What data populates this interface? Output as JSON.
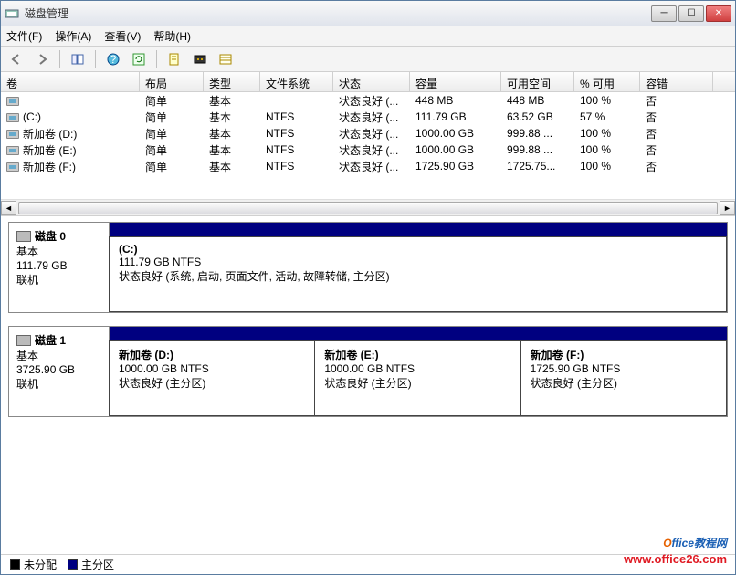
{
  "window": {
    "title": "磁盘管理"
  },
  "menus": {
    "file": "文件(F)",
    "action": "操作(A)",
    "view": "查看(V)",
    "help": "帮助(H)"
  },
  "toolbar_icons": [
    "back-icon",
    "forward-icon",
    "up-icon",
    "help-icon",
    "refresh-icon",
    "properties-icon",
    "list-icon",
    "detail-icon"
  ],
  "columns": {
    "c0": "卷",
    "c1": "布局",
    "c2": "类型",
    "c3": "文件系统",
    "c4": "状态",
    "c5": "容量",
    "c6": "可用空间",
    "c7": "% 可用",
    "c8": "容错"
  },
  "volumes": [
    {
      "name": "",
      "layout": "简单",
      "type": "基本",
      "fs": "",
      "status": "状态良好 (...",
      "cap": "448 MB",
      "free": "448 MB",
      "pct": "100 %",
      "ft": "否"
    },
    {
      "name": "(C:)",
      "layout": "简单",
      "type": "基本",
      "fs": "NTFS",
      "status": "状态良好 (...",
      "cap": "111.79 GB",
      "free": "63.52 GB",
      "pct": "57 %",
      "ft": "否"
    },
    {
      "name": "新加卷 (D:)",
      "layout": "简单",
      "type": "基本",
      "fs": "NTFS",
      "status": "状态良好 (...",
      "cap": "1000.00 GB",
      "free": "999.88 ...",
      "pct": "100 %",
      "ft": "否"
    },
    {
      "name": "新加卷 (E:)",
      "layout": "简单",
      "type": "基本",
      "fs": "NTFS",
      "status": "状态良好 (...",
      "cap": "1000.00 GB",
      "free": "999.88 ...",
      "pct": "100 %",
      "ft": "否"
    },
    {
      "name": "新加卷 (F:)",
      "layout": "简单",
      "type": "基本",
      "fs": "NTFS",
      "status": "状态良好 (...",
      "cap": "1725.90 GB",
      "free": "1725.75...",
      "pct": "100 %",
      "ft": "否"
    }
  ],
  "disks": [
    {
      "id": "磁盘 0",
      "type": "基本",
      "size": "111.79 GB",
      "status": "联机",
      "parts": [
        {
          "label": "(C:)",
          "sub": "111.79 GB NTFS",
          "state": "状态良好 (系统, 启动, 页面文件, 活动, 故障转储, 主分区)"
        }
      ]
    },
    {
      "id": "磁盘 1",
      "type": "基本",
      "size": "3725.90 GB",
      "status": "联机",
      "parts": [
        {
          "label": "新加卷  (D:)",
          "sub": "1000.00 GB NTFS",
          "state": "状态良好 (主分区)"
        },
        {
          "label": "新加卷  (E:)",
          "sub": "1000.00 GB NTFS",
          "state": "状态良好 (主分区)"
        },
        {
          "label": "新加卷  (F:)",
          "sub": "1725.90 GB NTFS",
          "state": "状态良好 (主分区)"
        }
      ]
    }
  ],
  "legend": {
    "unalloc": "未分配",
    "primary": "主分区"
  },
  "watermark": {
    "line1a": "O",
    "line1b": "ffice教程网",
    "line2": "www.office26.com"
  },
  "colors": {
    "header_bar": "#000080",
    "unalloc": "#000000",
    "primary": "#000080"
  }
}
